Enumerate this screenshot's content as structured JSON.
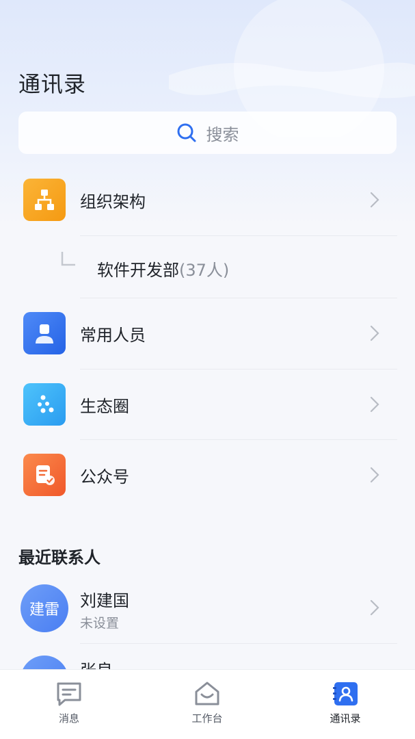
{
  "header": {
    "title": "通讯录"
  },
  "search": {
    "placeholder": "搜索"
  },
  "menu": [
    {
      "label": "组织架构",
      "icon": "org-chart-icon",
      "color": "#f7a31c"
    },
    {
      "label": "常用人员",
      "icon": "person-icon",
      "color": "#2f6ff0"
    },
    {
      "label": "生态圈",
      "icon": "ecosystem-icon",
      "color": "#3aaaf5"
    },
    {
      "label": "公众号",
      "icon": "document-check-icon",
      "color": "#f56b2e"
    }
  ],
  "department": {
    "name": "软件开发部",
    "count": "(37人)"
  },
  "recent": {
    "title": "最近联系人",
    "contacts": [
      {
        "avatar_text": "建雷",
        "name": "刘建国",
        "status": "未设置"
      },
      {
        "avatar_text": "",
        "name": "张良",
        "status": ""
      }
    ]
  },
  "tabs": [
    {
      "label": "消息",
      "icon": "message-icon",
      "active": false
    },
    {
      "label": "工作台",
      "icon": "workbench-icon",
      "active": false
    },
    {
      "label": "通讯录",
      "icon": "contacts-icon",
      "active": true
    }
  ],
  "colors": {
    "accent": "#2f6ff0",
    "background": "#f6f7fb"
  }
}
